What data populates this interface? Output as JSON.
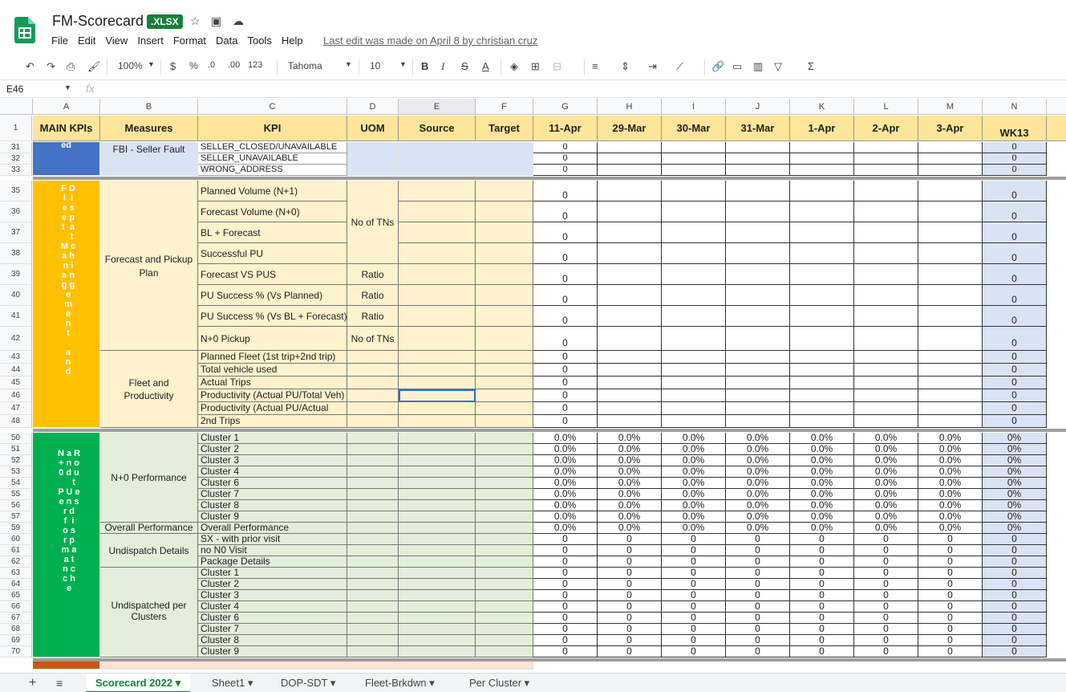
{
  "title_bar": {
    "doc_title": "FM-Scorecard",
    "badge": ".XLSX",
    "last_edit": "Last edit was made on April 8 by christian cruz"
  },
  "menu": [
    "File",
    "Edit",
    "View",
    "Insert",
    "Format",
    "Data",
    "Tools",
    "Help"
  ],
  "toolbar": {
    "zoom": "100%",
    "currency": "$",
    "percent": "%",
    "dec_dec": ".0",
    "dec_inc": ".00",
    "format": "123",
    "font": "Tahoma",
    "size": "10"
  },
  "name_box": "E46",
  "fx": "fx",
  "columns": [
    "A",
    "B",
    "C",
    "D",
    "E",
    "F",
    "G",
    "H",
    "I",
    "J",
    "K",
    "L",
    "M",
    "N"
  ],
  "header_row": {
    "row": "1",
    "cells": [
      "MAIN KPIs",
      "Measures",
      "KPI",
      "UOM",
      "Source",
      "Target",
      "11-Apr",
      "29-Mar",
      "30-Mar",
      "31-Mar",
      "1-Apr",
      "2-Apr",
      "3-Apr",
      "WK13"
    ]
  },
  "section_fbi": {
    "text": "ed",
    "measure": "FBI - Seller Fault",
    "kpis": [
      "SELLER_CLOSED/UNAVAILABLE",
      "SELLER_UNAVAILABLE",
      "WRONG_ADDRESS"
    ],
    "rows": [
      "31",
      "32",
      "33"
    ]
  },
  "section_fleet": {
    "vtext": "F D\nl  i\ne s\ne p\nt  a\n   t\nM c\na h\nn i\na n\ng g\ne\nm\ne\nn\nt\n\na\nn\nd",
    "measure1": "Forecast and Pickup Plan",
    "measure2": "Fleet and Productivity",
    "rows": [
      "35",
      "36",
      "37",
      "38",
      "39",
      "40",
      "41",
      "42"
    ],
    "kpis": [
      "Planned Volume (N+1)",
      "Forecast Volume (N+0)",
      "BL + Forecast",
      "Successful PU",
      "Forecast VS PUS",
      "PU Success % (Vs Planned)",
      "PU Success % (Vs BL + Forecast)",
      "N+0 Pickup"
    ],
    "uom": {
      "no_tns": "No of TNs",
      "ratio": "Ratio",
      "n0": "No of TNs"
    },
    "rows2": [
      "43",
      "44",
      "45",
      "46",
      "47",
      "48"
    ],
    "kpis2": [
      "Planned Fleet (1st trip+2nd trip)",
      "Total vehicle used",
      "Actual Trips",
      "Productivity (Actual PU/Total Veh)",
      "Productivity (Actual PU/Actual",
      "2nd Trips"
    ]
  },
  "section_n0": {
    "vtext": "N a R\n+ n o\n0 d u\n    t\nP U e\ne n s\nr d\nf  i\no s\nr p\nm a\na t\nn c\nc h\ne",
    "measure1": "N+0 Performance",
    "measure2": "Overall Performance",
    "measure3": "Undispatch Details",
    "measure4": "Undispatched per Clusters",
    "rows": [
      "50",
      "51",
      "52",
      "53",
      "54",
      "55",
      "56",
      "57",
      "59",
      "60",
      "61",
      "62",
      "63",
      "64",
      "65",
      "66",
      "67",
      "68",
      "69",
      "70"
    ],
    "kpis": [
      "Cluster 1",
      "Cluster 2",
      "Cluster 3",
      "Cluster 4",
      "Cluster 6",
      "Cluster 7",
      "Cluster 8",
      "Cluster 9",
      "Overall Performance",
      "SX - with prior visit",
      "no N0 Visit",
      "Package Details",
      "Cluster 1",
      "Cluster 2",
      "Cluster 3",
      "Cluster 4",
      "Cluster 6",
      "Cluster 7",
      "Cluster 8",
      "Cluster 9"
    ]
  },
  "values": {
    "zero": "0",
    "pct": "0.0%",
    "pct_wk": "0%"
  },
  "tabs": [
    "Scorecard 2022",
    "Sheet1",
    "DOP-SDT",
    "Fleet-Brkdwn",
    "Per Cluster"
  ],
  "colors": {
    "green": "#188038",
    "fleet": "#ffc000",
    "n0": "#00b050",
    "fbi": "#4472c4",
    "fill_yellow": "#fff2cc",
    "fill_green": "#e2efda",
    "fill_blue": "#dae3f3"
  }
}
